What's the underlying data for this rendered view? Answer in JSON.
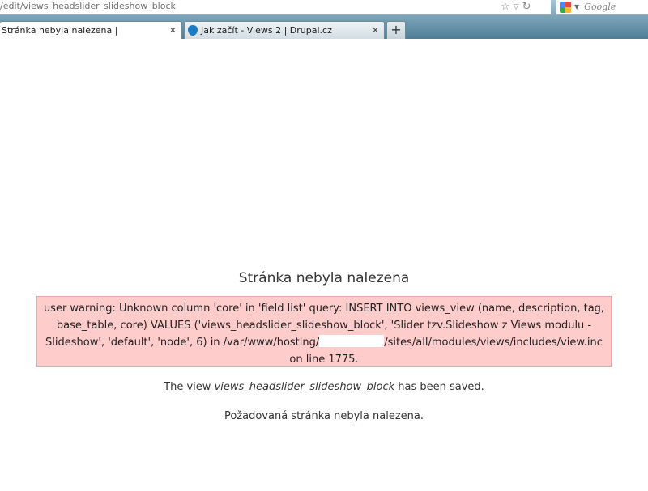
{
  "browser": {
    "url": "/edit/views_headslider_slideshow_block",
    "search_placeholder": "Google",
    "tabs": [
      {
        "label": "Stránka nebyla nalezena |",
        "active": true
      },
      {
        "label": "Jak začít - Views 2 | Drupal.cz",
        "active": false
      }
    ],
    "new_tab": "+",
    "close_glyph": "✕"
  },
  "page": {
    "title": "Stránka nebyla nalezena",
    "warning": {
      "before_redaction": "user warning: Unknown column 'core' in 'field list' query: INSERT INTO views_view (name, description, tag, base_table, core) VALUES ('views_headslider_slideshow_block', 'Slider tzv.Slideshow z Views modulu - Slideshow', 'default', 'node', 6) in /var/www/hosting/",
      "after_redaction": "/sites/all/modules/views/includes/view.inc on line 1775."
    },
    "status": {
      "prefix": "The view ",
      "view_name": "views_headslider_slideshow_block",
      "suffix": " has been saved."
    },
    "not_found": "Požadovaná stránka nebyla nalezena."
  },
  "colors": {
    "warning_bg": "#ffcccc",
    "warning_border": "#e9a8a8"
  }
}
